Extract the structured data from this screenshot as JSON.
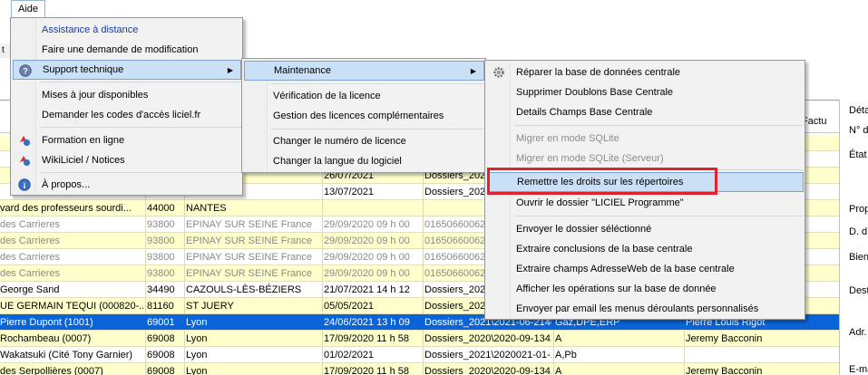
{
  "menubar": {
    "aide": "Aide"
  },
  "toolbar_fragment": "t",
  "grid": {
    "rows": [
      {
        "c1": "",
        "c2": "",
        "c3": "",
        "c4": "",
        "c5": "",
        "c6": "",
        "c7": "",
        "style": "yellow"
      },
      {
        "c1": "",
        "c2": "",
        "c3": "",
        "c4": "",
        "c5": "",
        "c6": "",
        "c7": "",
        "style": "white"
      },
      {
        "c1": "",
        "c2": "",
        "c3": "",
        "c4": "26/07/2021",
        "c5": "Dossiers_2021",
        "c6": "",
        "c7": "",
        "style": "yellow"
      },
      {
        "c1": "",
        "c2": "",
        "c3": "",
        "c4": "13/07/2021",
        "c5": "Dossiers_2021",
        "c6": "",
        "c7": "",
        "style": "white"
      },
      {
        "c1": "vard des professeurs sourdi...",
        "c2": "44000",
        "c3": "NANTES",
        "c4": "",
        "c5": "",
        "c6": "",
        "c7": "",
        "style": "yellow"
      },
      {
        "c1": "des Carrieres",
        "c2": "93800",
        "c3": "EPINAY SUR SEINE France",
        "c4": "29/09/2020 09 h 00",
        "c5": "01650660062",
        "c6": "",
        "c7": "",
        "style": "white grey"
      },
      {
        "c1": "des Carrieres",
        "c2": "93800",
        "c3": "EPINAY SUR SEINE France",
        "c4": "29/09/2020 09 h 00",
        "c5": "01650660062",
        "c6": "",
        "c7": "",
        "style": "yellow grey"
      },
      {
        "c1": "des Carrieres",
        "c2": "93800",
        "c3": "EPINAY SUR SEINE France",
        "c4": "29/09/2020 09 h 00",
        "c5": "01650660062",
        "c6": "",
        "c7": "",
        "style": "white grey"
      },
      {
        "c1": "des Carrieres",
        "c2": "93800",
        "c3": "EPINAY SUR SEINE France",
        "c4": "29/09/2020 09 h 00",
        "c5": "01650660062",
        "c6": "",
        "c7": "",
        "style": "yellow grey"
      },
      {
        "c1": "George Sand",
        "c2": "34490",
        "c3": "CAZOULS-LÈS-BÉZIERS",
        "c4": "21/07/2021 14 h 12",
        "c5": "Dossiers_2021",
        "c6": "",
        "c7": "",
        "style": "white"
      },
      {
        "c1": "UE GERMAIN TEQUI (000820-...",
        "c2": "81160",
        "c3": "ST JUERY",
        "c4": "05/05/2021",
        "c5": "Dossiers_2021",
        "c6": "",
        "c7": "",
        "style": "yellow"
      },
      {
        "c1": "Pierre Dupont (1001)",
        "c2": "69001",
        "c3": "Lyon",
        "c4": "24/06/2021 13 h 09",
        "c5": "Dossiers_2021\\2021-06-21460-...",
        "c6": "Gaz,DPE,ERP",
        "c7": "Pierre Louis Rigot",
        "style": "sel"
      },
      {
        "c1": "Rochambeau (0007)",
        "c2": "69008",
        "c3": "Lyon",
        "c4": "17/09/2020 11 h 58",
        "c5": "Dossiers_2020\\2020-09-13412-...",
        "c6": "A",
        "c7": "Jeremy Bacconin",
        "style": "yellow"
      },
      {
        "c1": "Wakatsuki (Cité Tony Garnier)",
        "c2": "69008",
        "c3": "Lyon",
        "c4": "01/02/2021",
        "c5": "Dossiers_2021\\2020021-01-174...",
        "c6": "A,Pb",
        "c7": "",
        "style": "white"
      },
      {
        "c1": "des Serpollières (0007)",
        "c2": "69008",
        "c3": "Lyon",
        "c4": "17/09/2020 11 h 58",
        "c5": "Dossiers_2020\\2020-09-13412-...",
        "c6": "A",
        "c7": "Jeremy Bacconin",
        "style": "yellow"
      }
    ],
    "factu_header": "Factu"
  },
  "right_panel": {
    "labels": [
      "Déta",
      "N° d",
      "État",
      "Prop",
      "D. d",
      "Bien",
      "Dest",
      "Adr.",
      "E-ma"
    ]
  },
  "menu1": {
    "items": [
      {
        "label": "Assistance à distance",
        "icon": "",
        "kind": "link"
      },
      {
        "label": "Faire une demande de modification",
        "icon": "",
        "kind": "normal"
      },
      {
        "label": "Support technique",
        "icon": "help-icon",
        "kind": "highlight",
        "submenu": true
      },
      {
        "label": "Mises à jour disponibles",
        "icon": "",
        "kind": "normal"
      },
      {
        "label": "Demander les codes d'accès liciel.fr",
        "icon": "",
        "kind": "normal"
      },
      {
        "label": "Formation en ligne",
        "icon": "formation-icon",
        "kind": "normal"
      },
      {
        "label": "WikiLiciel / Notices",
        "icon": "wiki-icon",
        "kind": "normal"
      },
      {
        "label": "À propos...",
        "icon": "info-icon",
        "kind": "normal"
      }
    ]
  },
  "menu2": {
    "items": [
      {
        "label": "Maintenance",
        "kind": "highlight",
        "submenu": true
      },
      {
        "label": "Vérification de la licence",
        "kind": "normal"
      },
      {
        "label": "Gestion des licences complémentaires",
        "kind": "normal"
      },
      {
        "label": "Changer le numéro de licence",
        "kind": "normal"
      },
      {
        "label": "Changer la langue du logiciel",
        "kind": "normal"
      }
    ]
  },
  "menu3": {
    "items": [
      {
        "label": "Réparer la base de données centrale",
        "icon": "gear-icon",
        "kind": "normal"
      },
      {
        "label": "Supprimer Doublons Base Centrale",
        "kind": "normal"
      },
      {
        "label": "Details Champs Base Centrale",
        "kind": "normal"
      },
      {
        "label": "Migrer en mode SQLite",
        "kind": "disabled"
      },
      {
        "label": "Migrer en mode SQLite (Serveur)",
        "kind": "disabled"
      },
      {
        "label": "Remettre les droits sur les répertoires",
        "kind": "highlight"
      },
      {
        "label": "Ouvrir le dossier \"LICIEL Programme\"",
        "kind": "normal"
      },
      {
        "label": "Envoyer le dossier séléctionné",
        "kind": "normal"
      },
      {
        "label": "Extraire conclusions de la base centrale",
        "kind": "normal"
      },
      {
        "label": "Extraire champs AdresseWeb de la base centrale",
        "kind": "normal"
      },
      {
        "label": "Afficher les opérations sur la base de donnée",
        "kind": "normal"
      },
      {
        "label": "Envoyer par email les menus déroulants personnalisés",
        "kind": "normal"
      }
    ]
  },
  "colors": {
    "highlight": "#c9e0f7",
    "selected_row": "#0a64d8",
    "row_yellow": "#ffffcc",
    "annotation": "#e0232b"
  }
}
